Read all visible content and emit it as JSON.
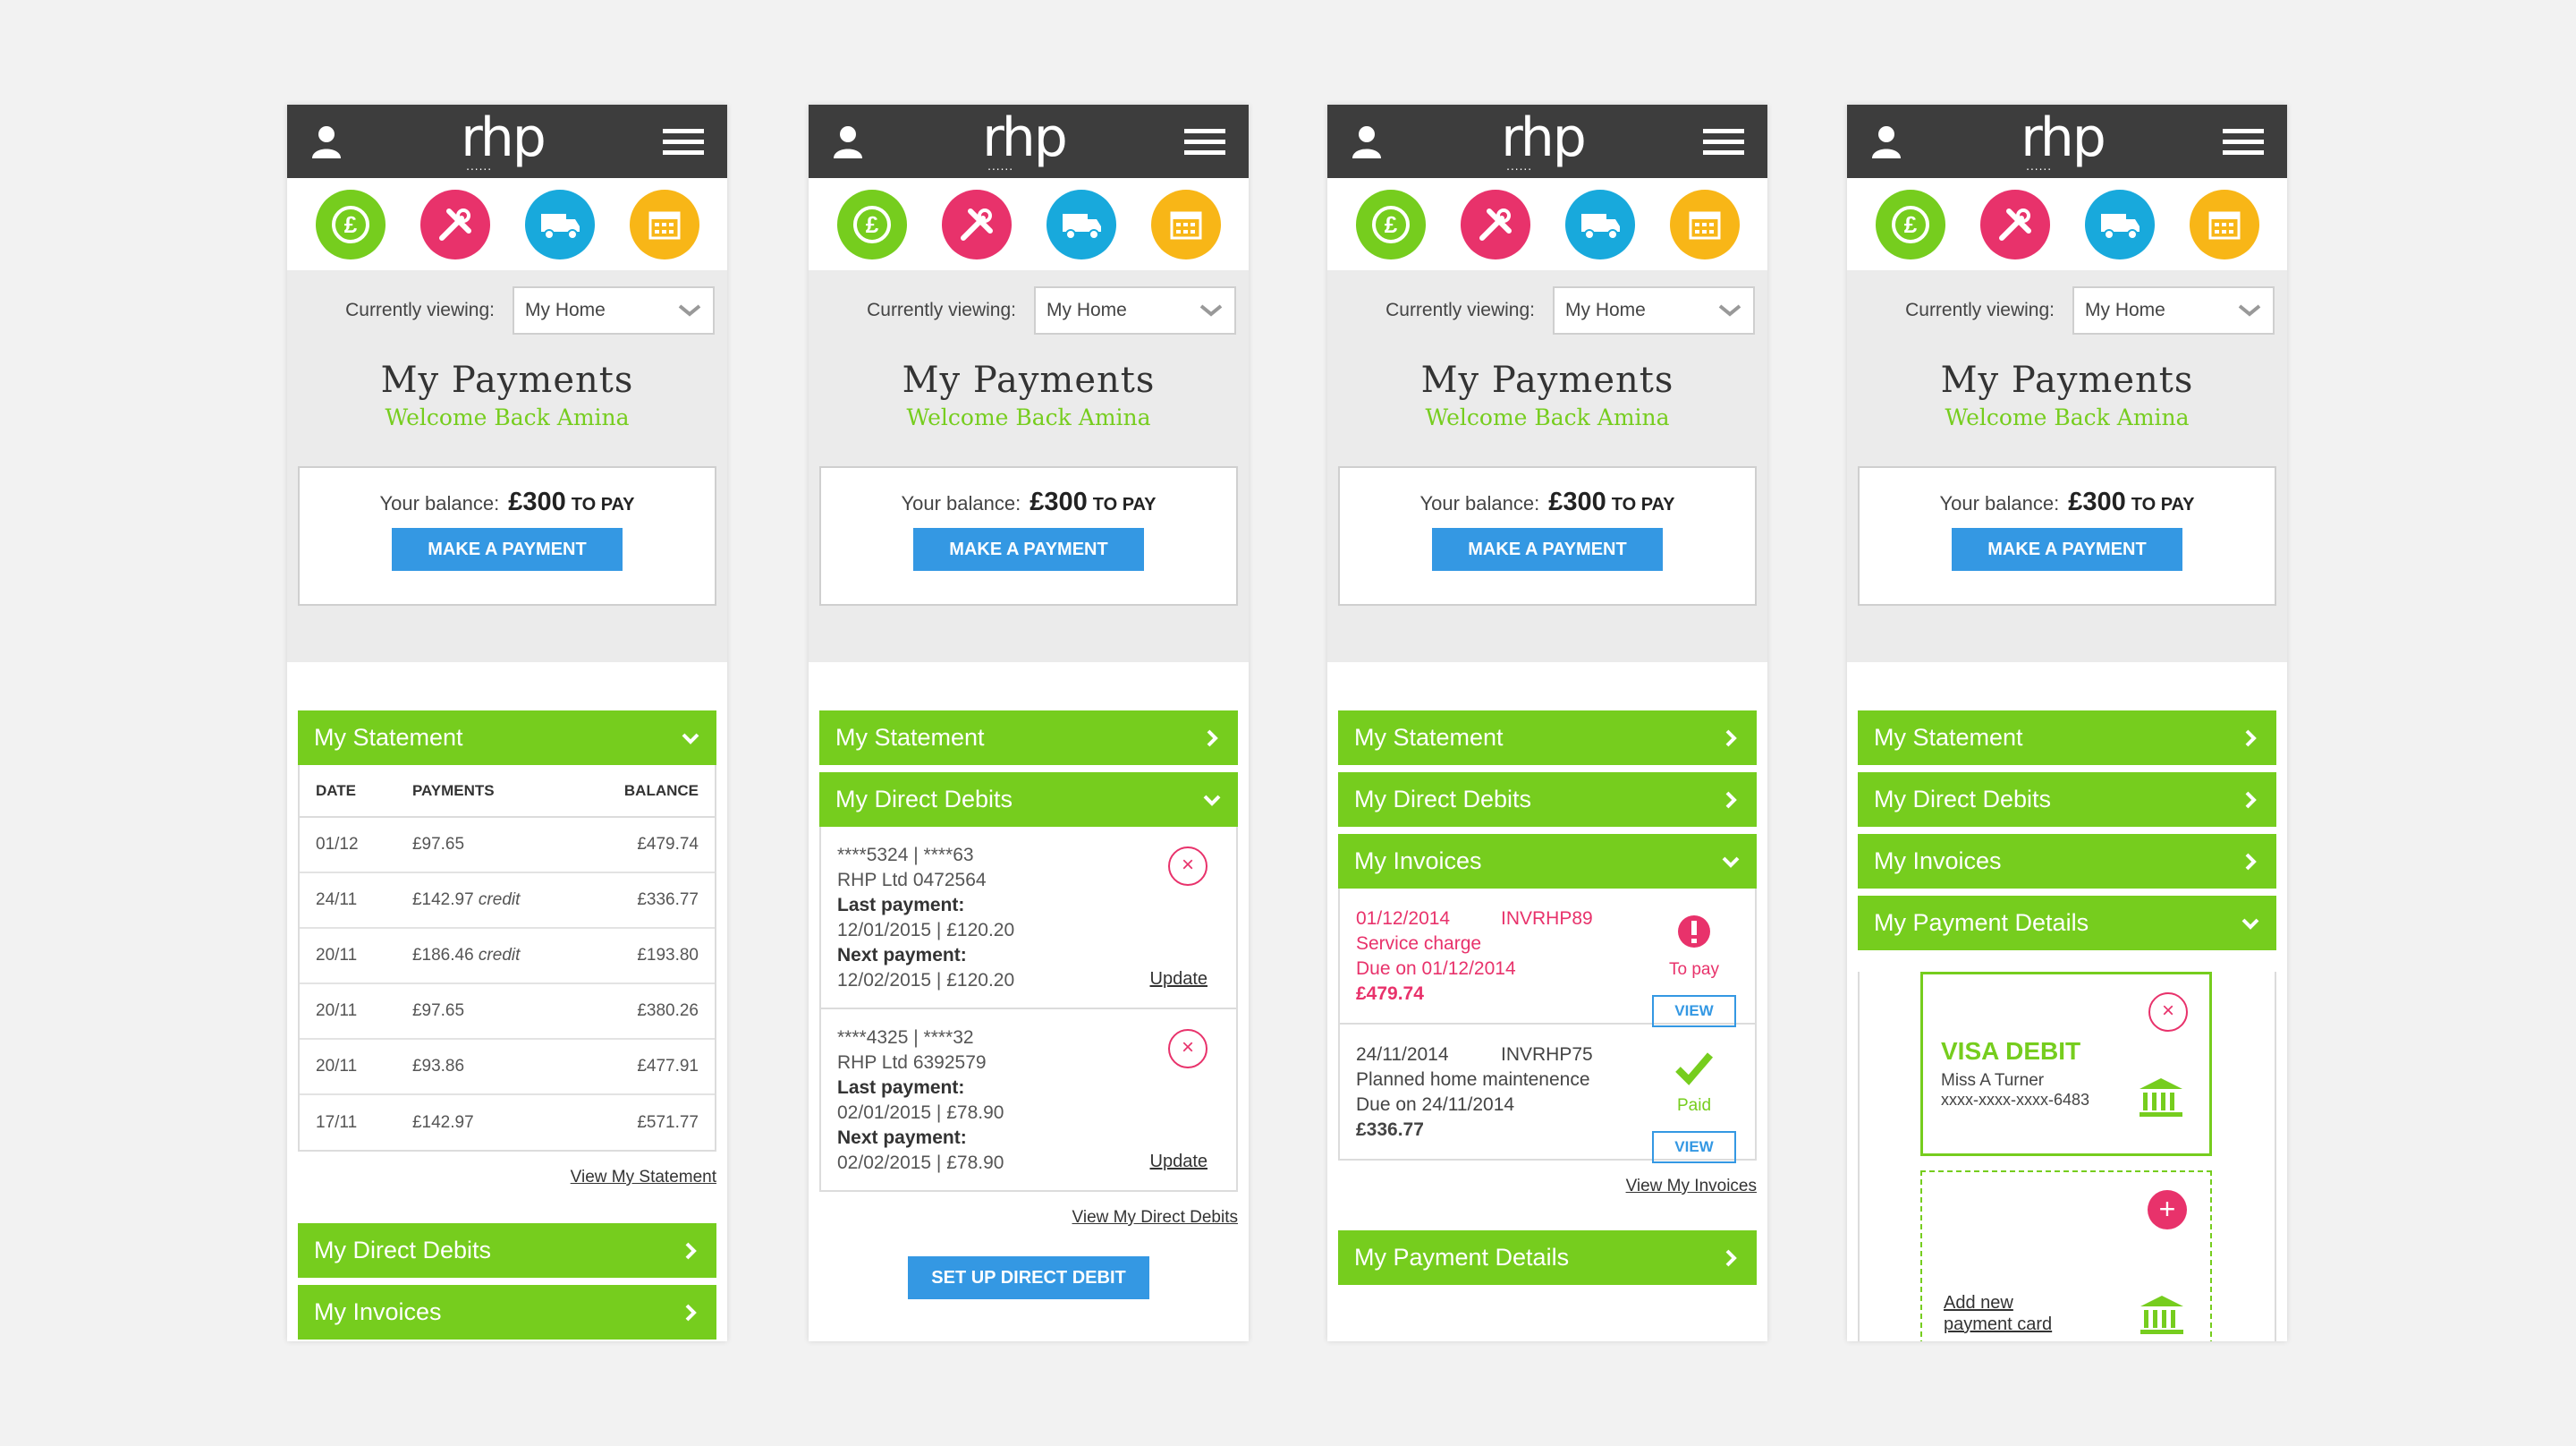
{
  "brand": "rhp",
  "brand_dots": "......",
  "colors": {
    "green": "#76cd1e",
    "pink": "#e8326b",
    "blue": "#18a9dc",
    "yellow": "#f8b617",
    "button": "#3498e3"
  },
  "top_icons": [
    "pound-icon",
    "tools-icon",
    "van-icon",
    "calendar-icon"
  ],
  "viewing": {
    "label": "Currently viewing:",
    "value": "My Home"
  },
  "hero": {
    "title": "My Payments",
    "welcome": "Welcome Back Amina"
  },
  "balance": {
    "label": "Your balance:",
    "amount": "£300",
    "suffix": "TO PAY",
    "button": "MAKE A PAYMENT"
  },
  "sections": {
    "statement": "My Statement",
    "direct_debits": "My Direct Debits",
    "invoices": "My Invoices",
    "payment_details": "My Payment Details"
  },
  "statement": {
    "headers": [
      "DATE",
      "PAYMENTS",
      "BALANCE"
    ],
    "rows": [
      {
        "date": "01/12",
        "payment": "£97.65",
        "note": "",
        "balance": "£479.74"
      },
      {
        "date": "24/11",
        "payment": "£142.97",
        "note": "credit",
        "balance": "£336.77"
      },
      {
        "date": "20/11",
        "payment": "£186.46",
        "note": "credit",
        "balance": "£193.80"
      },
      {
        "date": "20/11",
        "payment": "£97.65",
        "note": "",
        "balance": "£380.26"
      },
      {
        "date": "20/11",
        "payment": "£93.86",
        "note": "",
        "balance": "£477.91"
      },
      {
        "date": "17/11",
        "payment": "£142.97",
        "note": "",
        "balance": "£571.77"
      }
    ],
    "view_link": "View My Statement"
  },
  "direct_debits": {
    "items": [
      {
        "account": "****5324  |  ****63",
        "payee": "RHP Ltd    0472564",
        "last_label": "Last payment:",
        "last": "12/01/2015  |  £120.20",
        "next_label": "Next payment:",
        "next": "12/02/2015  |  £120.20",
        "update": "Update"
      },
      {
        "account": "****4325  |  ****32",
        "payee": "RHP Ltd    6392579",
        "last_label": "Last payment:",
        "last": "02/01/2015  |  £78.90",
        "next_label": "Next payment:",
        "next": "02/02/2015  |  £78.90",
        "update": "Update"
      }
    ],
    "view_link": "View My Direct Debits",
    "setup_button": "SET UP DIRECT DEBIT"
  },
  "invoices": {
    "items": [
      {
        "date": "01/12/2014",
        "number": "INVRHP89",
        "desc": "Service charge",
        "due": "Due on 01/12/2014",
        "amount": "£479.74",
        "status": "To pay",
        "view": "VIEW"
      },
      {
        "date": "24/11/2014",
        "number": "INVRHP75",
        "desc": "Planned home maintenence",
        "due": "Due on 24/11/2014",
        "amount": "£336.77",
        "status": "Paid",
        "view": "VIEW"
      }
    ],
    "view_link": "View My Invoices"
  },
  "payment_details": {
    "card_type": "VISA DEBIT",
    "card_name": "Miss A Turner",
    "card_number": "xxxx-xxxx-xxxx-6483",
    "add_line1": "Add new",
    "add_line2": "payment card"
  }
}
